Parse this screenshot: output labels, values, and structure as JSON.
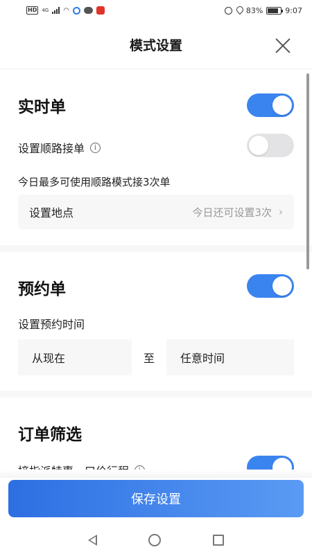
{
  "status_bar": {
    "hd": "HD",
    "network": "4G",
    "battery": "83%",
    "battery_level": 0.83,
    "time": "9:07"
  },
  "header": {
    "title": "模式设置"
  },
  "realtime": {
    "title": "实时单",
    "enabled": true,
    "route_label": "设置顺路接单",
    "route_enabled": false,
    "route_note": "今日最多可使用顺路模式接3次单",
    "location_label": "设置地点",
    "location_value": "今日还可设置3次"
  },
  "reservation": {
    "title": "预约单",
    "enabled": true,
    "time_label": "设置预约时间",
    "time_from": "从现在",
    "time_sep": "至",
    "time_to": "任意时间"
  },
  "filter": {
    "title": "订单筛选",
    "item_label": "接指派特惠一口价行程",
    "item_enabled": true
  },
  "footer": {
    "save_label": "保存设置"
  },
  "colors": {
    "accent": "#3a84ef",
    "toggle_off": "#e3e3e6"
  }
}
